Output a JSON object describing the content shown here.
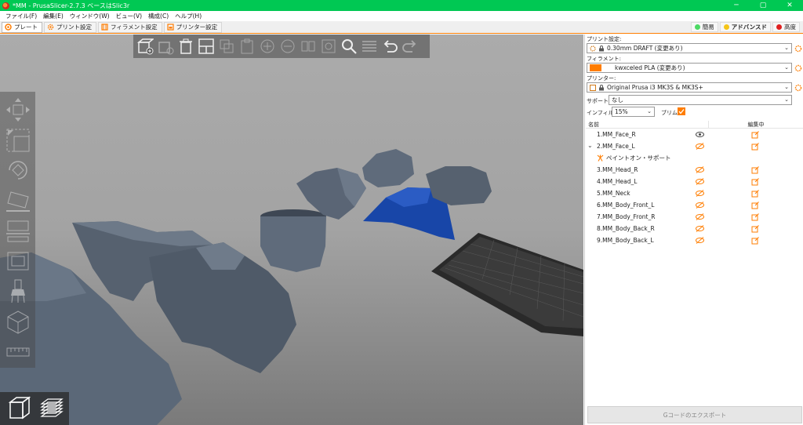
{
  "window": {
    "title": "*MM - PrusaSlicer-2.7.3 ベースはSlic3r",
    "minimize": "─",
    "maximize": "▢",
    "close": "✕"
  },
  "menu": [
    "ファイル(F)",
    "編集(E)",
    "ウィンドウ(W)",
    "ビュー(V)",
    "構成(C)",
    "ヘルプ(H)"
  ],
  "tabs": [
    {
      "label": "プレート",
      "icon": "plate-icon"
    },
    {
      "label": "プリント設定",
      "icon": "gear-icon"
    },
    {
      "label": "フィラメント設定",
      "icon": "filament-icon"
    },
    {
      "label": "プリンター設定",
      "icon": "printer-icon"
    }
  ],
  "modes": [
    {
      "label": "簡易",
      "color": "#4cd964"
    },
    {
      "label": "アドバンスド",
      "color": "#f5c518"
    },
    {
      "label": "高度",
      "color": "#e02020"
    }
  ],
  "sidebar": {
    "print_label": "プリント設定:",
    "print_value": "0.30mm DRAFT (変更あり)",
    "filament_label": "フィラメント:",
    "filament_value": "kwxceled PLA (変更あり)",
    "filament_color": "#ff7d00",
    "printer_label": "プリンター:",
    "printer_value": "Original Prusa i3 MK3S & MK3S+",
    "support_label": "サポート:",
    "support_value": "なし",
    "infill_label": "インフィル:",
    "infill_value": "15%",
    "brim_label": "ブリム:",
    "col_name": "名前",
    "col_edit": "編集中",
    "objects": [
      {
        "name": "1.MM_Face_R",
        "visible": true
      },
      {
        "name": "2.MM_Face_L",
        "visible": false,
        "expanded": true
      },
      {
        "name": "ペイントオン・サポート",
        "sub": true
      },
      {
        "name": "3.MM_Head_R",
        "visible": false
      },
      {
        "name": "4.MM_Head_L",
        "visible": false
      },
      {
        "name": "5.MM_Neck",
        "visible": false
      },
      {
        "name": "6.MM_Body_Front_L",
        "visible": false
      },
      {
        "name": "7.MM_Body_Front_R",
        "visible": false
      },
      {
        "name": "8.MM_Body_Back_R",
        "visible": false
      },
      {
        "name": "9.MM_Body_Back_L",
        "visible": false
      }
    ],
    "export_label": "Gコードのエクスポート"
  },
  "colors": {
    "accent": "#ff7d00",
    "titlebar": "#00c853",
    "model": "#5b6878",
    "selected_model": "#1846a8"
  }
}
